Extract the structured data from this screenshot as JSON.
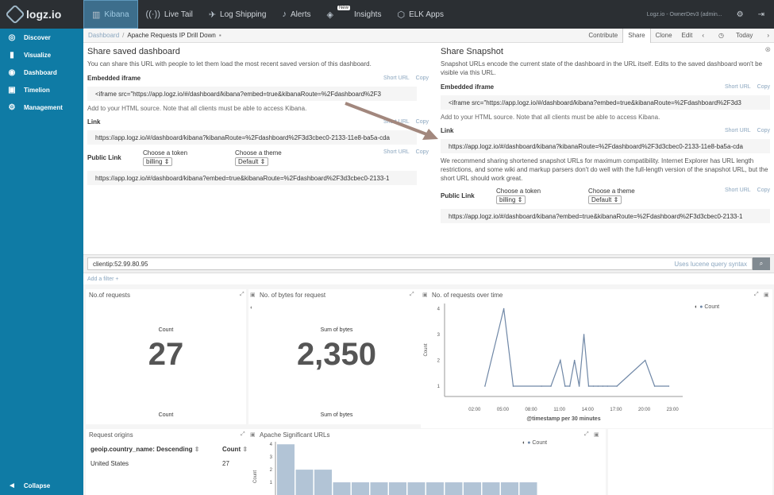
{
  "brand": "logz.io",
  "nav": [
    {
      "label": "Kibana",
      "icon": "kibana-icon",
      "active": true
    },
    {
      "label": "Live Tail",
      "icon": "live-tail-icon"
    },
    {
      "label": "Log Shipping",
      "icon": "log-shipping-icon"
    },
    {
      "label": "Alerts",
      "icon": "bell-icon"
    },
    {
      "label": "Insights",
      "icon": "insights-icon",
      "badge": "New"
    },
    {
      "label": "ELK Apps",
      "icon": "elk-apps-icon"
    }
  ],
  "account": "Logz.io - OwnerDev3 (admin...",
  "sidebar": {
    "items": [
      {
        "label": "Discover",
        "icon": "compass-icon"
      },
      {
        "label": "Visualize",
        "icon": "bar-chart-icon"
      },
      {
        "label": "Dashboard",
        "icon": "dashboard-icon"
      },
      {
        "label": "Timelion",
        "icon": "timelion-icon"
      },
      {
        "label": "Management",
        "icon": "gear-icon"
      }
    ],
    "collapse": "Collapse"
  },
  "breadcrumb": {
    "root": "Dashboard",
    "current": "Apache Requests IP Drill Down"
  },
  "actions": [
    "Contribute",
    "Share",
    "Clone",
    "Edit",
    "Today"
  ],
  "share_saved": {
    "title": "Share saved dashboard",
    "desc": "You can share this URL with people to let them load the most recent saved version of this dashboard.",
    "embed_label": "Embedded iframe",
    "embed_code": "<iframe src=\"https://app.logz.io/#/dashboard/kibana?embed=true&kibanaRoute=%2Fdashboard%2F3",
    "embed_note": "Add to your HTML source. Note that all clients must be able to access Kibana.",
    "link_label": "Link",
    "link_url": "https://app.logz.io/#/dashboard/kibana?kibanaRoute=%2Fdashboard%2F3d3cbec0-2133-11e8-ba5a-cda",
    "public_label": "Public Link",
    "token_label": "Choose a token",
    "token_value": "billing",
    "theme_label": "Choose a theme",
    "theme_value": "Default",
    "public_url": "https://app.logz.io/#/dashboard/kibana?embed=true&kibanaRoute=%2Fdashboard%2F3d3cbec0-2133-1"
  },
  "share_snapshot": {
    "title": "Share Snapshot",
    "desc": "Snapshot URLs encode the current state of the dashboard in the URL itself. Edits to the saved dashboard won't be visible via this URL.",
    "embed_label": "Embedded iframe",
    "embed_code": "<iframe src=\"https://app.logz.io/#/dashboard/kibana?embed=true&kibanaRoute=%2Fdashboard%2F3d3",
    "embed_note": "Add to your HTML source. Note that all clients must be able to access Kibana.",
    "link_label": "Link",
    "link_url": "https://app.logz.io/#/dashboard/kibana?kibanaRoute=%2Fdashboard%2F3d3cbec0-2133-11e8-ba5a-cda",
    "link_note": "We recommend sharing shortened snapshot URLs for maximum compatibility. Internet Explorer has URL length restrictions, and some wiki and markup parsers don't do well with the full-length version of the snapshot URL, but the short URL should work great.",
    "public_label": "Public Link",
    "token_label": "Choose a token",
    "token_value": "billing",
    "theme_label": "Choose a theme",
    "theme_value": "Default",
    "public_url": "https://app.logz.io/#/dashboard/kibana?embed=true&kibanaRoute=%2Fdashboard%2F3d3cbec0-2133-1"
  },
  "short_url": "Short URL",
  "copy": "Copy",
  "query": {
    "value": "clientip:52.99.80.95",
    "hint": "Uses lucene query syntax"
  },
  "add_filter": "Add a filter +",
  "panels": {
    "requests": {
      "title": "No.of requests",
      "label": "Count",
      "value": "27",
      "footer": "Count"
    },
    "bytes": {
      "title": "No. of bytes for request",
      "label": "Sum of bytes",
      "value": "2,350",
      "footer": "Sum of bytes"
    },
    "overtime": {
      "title": "No. of requests over time",
      "legend": "Count",
      "ylabel": "Count",
      "xlabel": "@timestamp per 30 minutes"
    },
    "origins": {
      "title": "Request origins",
      "col1": "geoip.country_name: Descending",
      "col2": "Count",
      "row_country": "United States",
      "row_count": "27"
    },
    "urls": {
      "title": "Apache Significant URLs",
      "legend": "Count",
      "ylabel": "Count"
    }
  },
  "chart_data": [
    {
      "type": "line",
      "title": "No. of requests over time",
      "xlabel": "@timestamp per 30 minutes",
      "ylabel": "Count",
      "x_ticks": [
        "02:00",
        "05:00",
        "08:00",
        "11:00",
        "14:00",
        "17:00",
        "20:00",
        "23:00"
      ],
      "y_ticks": [
        1,
        2,
        3,
        4
      ],
      "ylim": [
        0.6,
        4.2
      ],
      "x_hours": [
        3.1,
        5.1,
        6.1,
        9.1,
        10.1,
        11.1,
        11.6,
        12.1,
        12.6,
        13.1,
        13.6,
        14.1,
        14.6,
        15.1,
        15.6,
        16.1,
        17.1,
        20.1,
        21.1,
        22.6
      ],
      "values": [
        1,
        4,
        1,
        1,
        1,
        2,
        1,
        1,
        2,
        1,
        3,
        1,
        1,
        1,
        1,
        1,
        1,
        2,
        1,
        1
      ],
      "series": [
        {
          "name": "Count",
          "color": "#6f87a6"
        }
      ]
    },
    {
      "type": "bar",
      "title": "Apache Significant URLs",
      "ylabel": "Count",
      "y_ticks": [
        1,
        2,
        3,
        4
      ],
      "ylim": [
        0,
        4.2
      ],
      "values": [
        4,
        2,
        2,
        1,
        1,
        1,
        1,
        1,
        1,
        1,
        1,
        1,
        1,
        1
      ],
      "series": [
        {
          "name": "Count",
          "color": "#b2c4d6"
        }
      ]
    }
  ],
  "colors": {
    "sidebar": "#0f7ba5",
    "topnav": "#2b2f33",
    "link": "#8ba6bf",
    "arrow": "#a2877d"
  }
}
